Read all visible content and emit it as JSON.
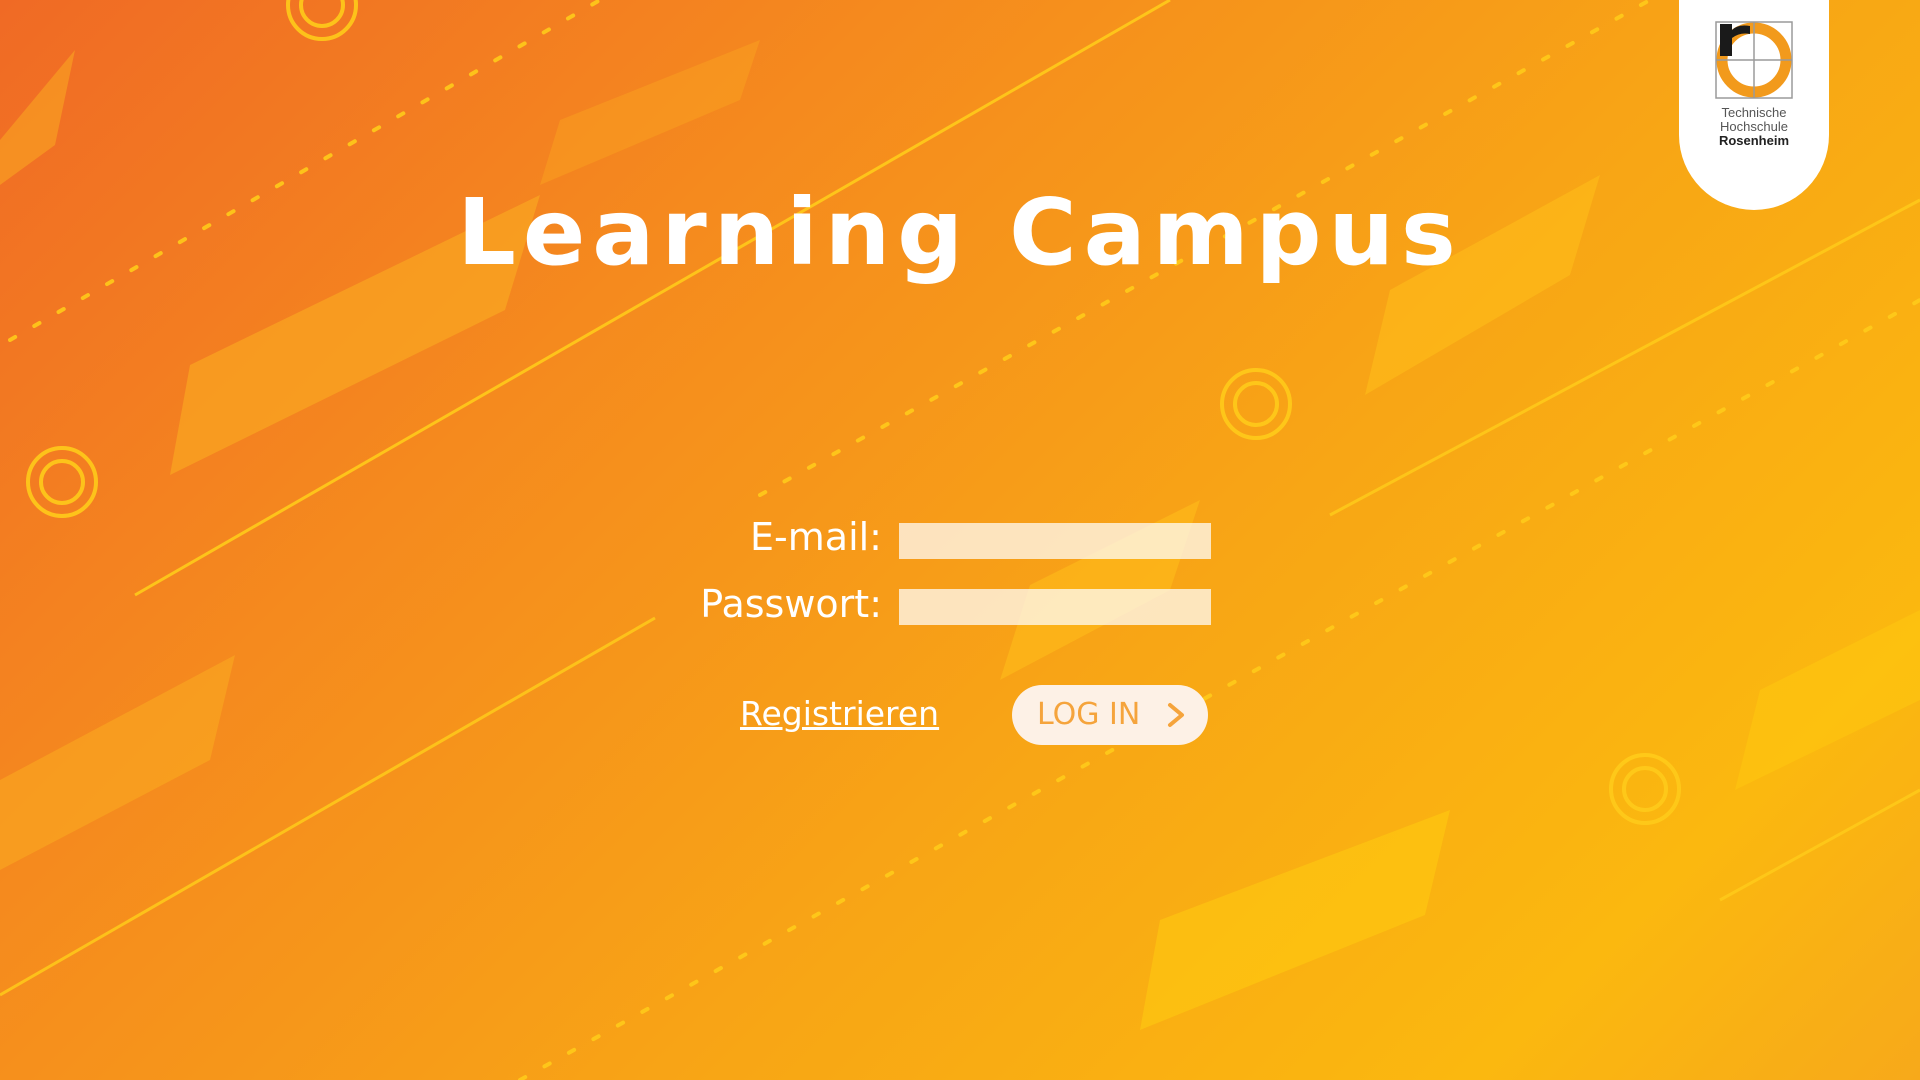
{
  "app": {
    "title": "Learning Campus"
  },
  "logo": {
    "line1": "Technische",
    "line2": "Hochschule",
    "line3": "Rosenheim"
  },
  "form": {
    "email_label": "E-mail:",
    "email_value": "",
    "password_label": "Passwort:",
    "password_value": "",
    "register_label": "Registrieren",
    "login_label": "LOG IN"
  },
  "icons": {
    "login_chevron": "chevron-right-icon",
    "logo_mark": "university-logo-icon"
  },
  "colors": {
    "background_start": "#f06a25",
    "background_end": "#fbb80f",
    "text": "#ffffff",
    "button_bg": "#fdf1e6",
    "button_text": "#f5a43c"
  }
}
